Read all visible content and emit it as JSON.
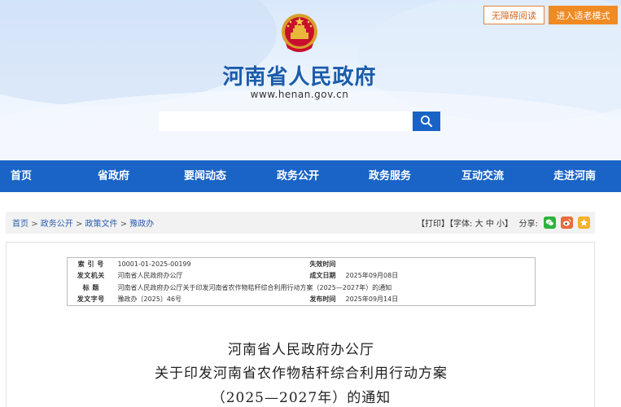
{
  "top_links": {
    "accessibility": "无障碍阅读",
    "elder_mode": "进入适老模式"
  },
  "site": {
    "title": "河南省人民政府",
    "url": "www.henan.gov.cn"
  },
  "search": {
    "placeholder": ""
  },
  "nav": {
    "items": [
      "首页",
      "省政府",
      "要闻动态",
      "政务公开",
      "政务服务",
      "互动交流",
      "走进河南"
    ]
  },
  "breadcrumb": {
    "items": [
      "首页",
      "政务公开",
      "政策文件",
      "豫政办"
    ],
    "separator": ">"
  },
  "tools": {
    "print": "【打印】",
    "font_label": "【字体:",
    "font_large": "大",
    "font_medium": "中",
    "font_small": "小",
    "font_close": "】",
    "share_label": "分享:",
    "share_icons": [
      "wechat-icon",
      "weibo-icon",
      "favorite-icon"
    ]
  },
  "meta": {
    "index_label": "索  引  号",
    "index_value": "10001-01-2025-00199",
    "expire_label": "失效时间",
    "expire_value": "",
    "issuer_label": "发文机关",
    "issuer_value": "河南省人民政府办公厅",
    "written_label": "成文日期",
    "written_value": "2025年09月08日",
    "title_label": "标      题",
    "title_value": "河南省人民政府办公厅关于印发河南省农作物秸秆综合利用行动方案（2025—2027年）的通知",
    "docno_label": "发文字号",
    "docno_value": "豫政办〔2025〕46号",
    "publish_label": "发布时间",
    "publish_value": "2025年09月14日"
  },
  "document": {
    "title_line1": "河南省人民政府办公厅",
    "title_line2": "关于印发河南省农作物秸秆综合利用行动方案",
    "title_line3": "（2025—2027年）的通知"
  },
  "colors": {
    "nav_bg": "#1964c6",
    "title_blue": "#1b5cab",
    "elder_orange": "#f08a22",
    "wechat_green": "#2cb33d",
    "weibo_orange": "#e96b3b",
    "favorite_yellow": "#f3b22a"
  }
}
